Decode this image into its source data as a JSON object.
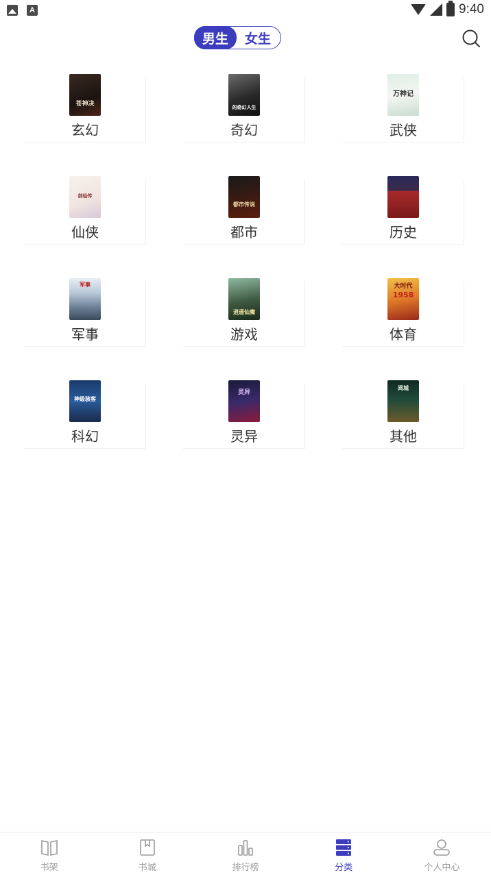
{
  "status_bar": {
    "time": "9:40",
    "left_icons": [
      "image-icon",
      "a-icon"
    ],
    "right_icons": [
      "wifi-icon",
      "signal-icon",
      "battery-icon"
    ]
  },
  "header": {
    "gender_tabs": [
      {
        "label": "男生",
        "active": true
      },
      {
        "label": "女生",
        "active": false
      }
    ],
    "search_icon": "search-icon"
  },
  "categories": [
    {
      "label": "玄幻"
    },
    {
      "label": "奇幻"
    },
    {
      "label": "武侠"
    },
    {
      "label": "仙侠"
    },
    {
      "label": "都市"
    },
    {
      "label": "历史"
    },
    {
      "label": "军事"
    },
    {
      "label": "游戏"
    },
    {
      "label": "体育"
    },
    {
      "label": "科幻"
    },
    {
      "label": "灵异"
    },
    {
      "label": "其他"
    }
  ],
  "bottom_nav": [
    {
      "label": "书架",
      "icon": "book-open-icon",
      "active": false
    },
    {
      "label": "书城",
      "icon": "bookmark-book-icon",
      "active": false
    },
    {
      "label": "排行榜",
      "icon": "bar-chart-icon",
      "active": false
    },
    {
      "label": "分类",
      "icon": "category-list-icon",
      "active": true
    },
    {
      "label": "个人中心",
      "icon": "user-icon",
      "active": false
    }
  ],
  "colors": {
    "accent": "#3c3cbf",
    "inactive": "#9a9a9a"
  }
}
